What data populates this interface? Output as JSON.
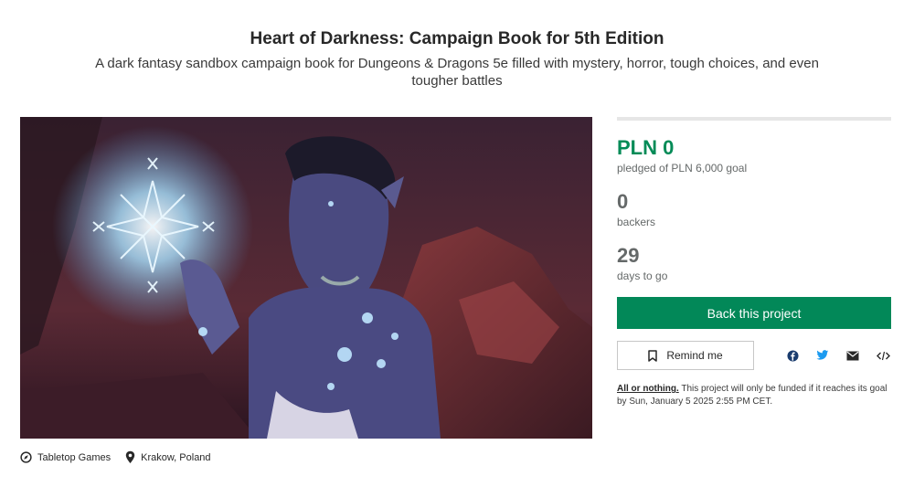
{
  "project": {
    "title": "Heart of Darkness: Campaign Book for 5th Edition",
    "blurb": "A dark fantasy sandbox campaign book for Dungeons & Dragons 5e filled with mystery, horror, tough choices, and even tougher battles"
  },
  "meta": {
    "category": "Tabletop Games",
    "location": "Krakow, Poland"
  },
  "stats": {
    "pledged": "PLN 0",
    "pledged_label": "pledged of PLN 6,000 goal",
    "progress_fraction": 0,
    "backers": "0",
    "backers_label": "backers",
    "days": "29",
    "days_label": "days to go"
  },
  "actions": {
    "back_label": "Back this project",
    "remind_label": "Remind me"
  },
  "share_icons": [
    "facebook-icon",
    "twitter-icon",
    "email-icon",
    "embed-icon"
  ],
  "notice": {
    "lead": "All or nothing.",
    "text": " This project will only be funded if it reaches its goal by Sun, January 5 2025 2:55 PM CET."
  },
  "colors": {
    "accent": "#028858",
    "twitter": "#1d9bf0",
    "facebook": "#1877f2"
  }
}
